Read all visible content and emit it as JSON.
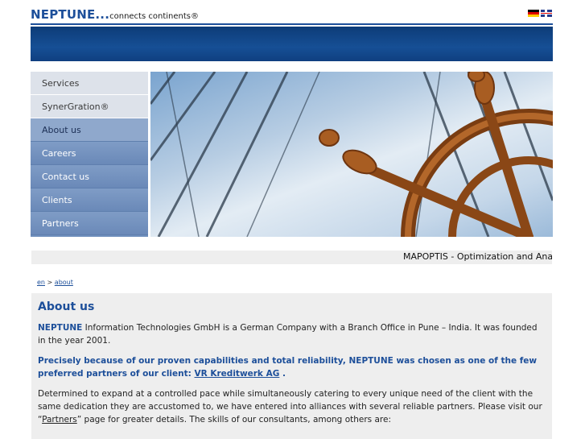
{
  "header": {
    "brand": "NEPTUNE...",
    "tagline": "connects continents®",
    "languages": [
      {
        "code": "de",
        "icon": "german-flag-icon"
      },
      {
        "code": "en",
        "icon": "uk-flag-icon"
      }
    ],
    "colors": {
      "brand": "#1d4f9a",
      "banner": "#164f95"
    }
  },
  "nav": {
    "items": [
      {
        "label": "Services"
      },
      {
        "label": "SynerGration®"
      },
      {
        "label": "About us"
      },
      {
        "label": "Careers"
      },
      {
        "label": "Contact us"
      },
      {
        "label": "Clients"
      },
      {
        "label": "Partners"
      }
    ],
    "active": "About us"
  },
  "ticker": {
    "text": "MAPOPTIS - Optimization and Anal"
  },
  "breadcrumb": {
    "root": "en",
    "separator": ">",
    "current": "about"
  },
  "main": {
    "title": "About us",
    "p1": {
      "brand": "NEPTUNE",
      "text": " Information Technologies GmbH is a German Company with a Branch Office in Pune – India. It was founded  in the year 2001."
    },
    "p2": {
      "text": "Precisely because of our proven capabilities and total reliability, NEPTUNE was chosen as one of the few preferred partners of our client: ",
      "link": "VR Kreditwerk  AG",
      "suffix": " ."
    },
    "p3": {
      "text": "Determined to expand at a controlled pace while simultaneously catering to every unique need of the client with the same dedication they are accustomed to, we have entered into alliances with several reliable partners. Please visit our “",
      "link": "Partners",
      "suffix": "” page for greater details. The skills of our consultants, among others are:"
    }
  }
}
